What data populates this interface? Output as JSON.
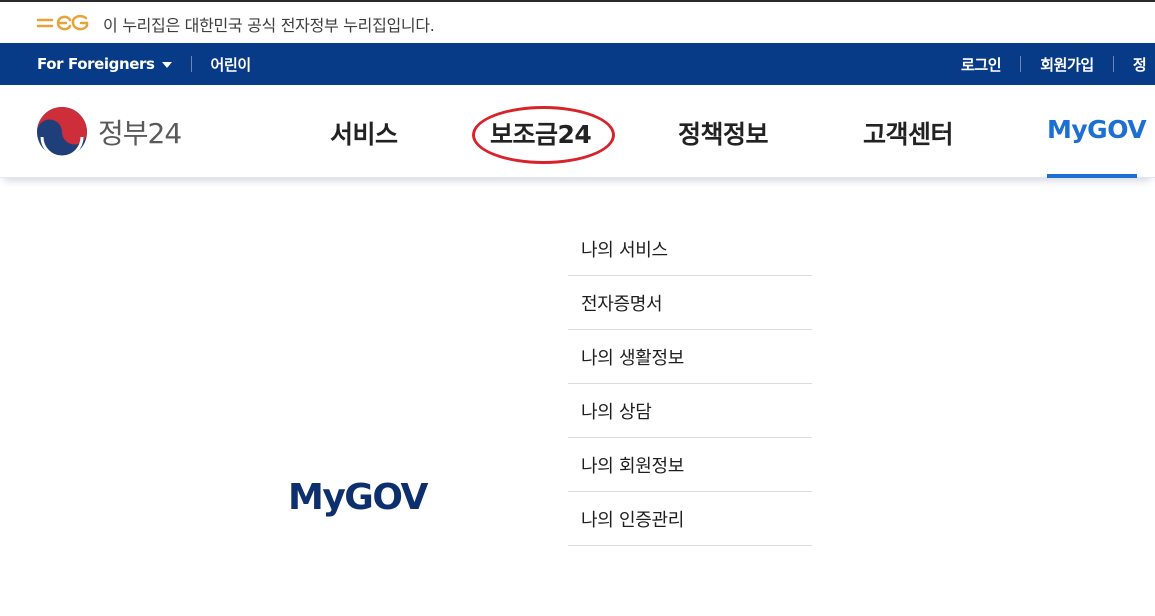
{
  "notice": {
    "logo_icon": "eg-government-logo",
    "text": "이 누리집은 대한민국 공식 전자정부 누리집입니다."
  },
  "utilbar": {
    "left": [
      {
        "label": "For Foreigners",
        "icon": "caret-down-icon"
      },
      {
        "label": "어린이"
      }
    ],
    "right": [
      {
        "label": "로그인"
      },
      {
        "label": "회원가입"
      },
      {
        "label": "정"
      }
    ]
  },
  "header": {
    "brand": "정부24",
    "brand_icon": "taegeuk-icon",
    "nav": [
      {
        "label": "서비스"
      },
      {
        "label": "보조금24"
      },
      {
        "label": "정책정보"
      },
      {
        "label": "고객센터"
      },
      {
        "label": "MyGOV"
      }
    ],
    "active_nav": "MyGOV",
    "highlighted_nav": "보조금24"
  },
  "mega_menu": {
    "title": "MyGOV",
    "items": [
      {
        "label": "나의 서비스"
      },
      {
        "label": "전자증명서"
      },
      {
        "label": "나의 생활정보"
      },
      {
        "label": "나의 상담"
      },
      {
        "label": "나의 회원정보"
      },
      {
        "label": "나의 인증관리"
      }
    ]
  },
  "colors": {
    "utilbar_bg": "#073a87",
    "active_nav": "#1d6fd1",
    "annotation_red": "#d8232a",
    "menu_title": "#0d2f6e"
  }
}
